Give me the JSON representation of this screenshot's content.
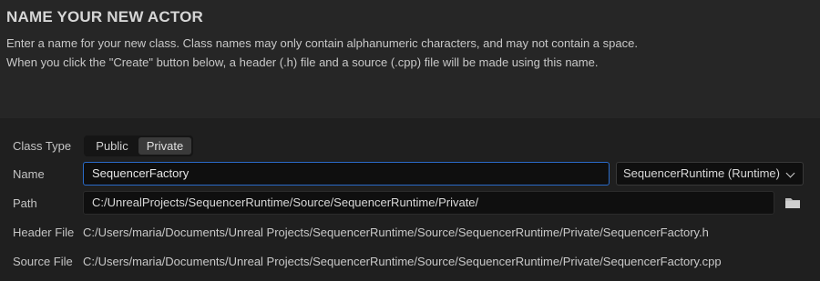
{
  "dialog": {
    "title": "NAME YOUR NEW ACTOR",
    "description_line1": "Enter a name for your new class. Class names may only contain alphanumeric characters, and may not contain a space.",
    "description_line2": "When you click the \"Create\" button below, a header (.h) file and a source (.cpp) file will be made using this name."
  },
  "form": {
    "class_type": {
      "label": "Class Type",
      "options": [
        "Public",
        "Private"
      ],
      "selected": "Private"
    },
    "name": {
      "label": "Name",
      "value": "SequencerFactory"
    },
    "module": {
      "selected": "SequencerRuntime (Runtime)"
    },
    "path": {
      "label": "Path",
      "value": "C:/UnrealProjects/SequencerRuntime/Source/SequencerRuntime/Private/"
    },
    "header_file": {
      "label": "Header File",
      "value": "C:/Users/maria/Documents/Unreal Projects/SequencerRuntime/Source/SequencerRuntime/Private/SequencerFactory.h"
    },
    "source_file": {
      "label": "Source File",
      "value": "C:/Users/maria/Documents/Unreal Projects/SequencerRuntime/Source/SequencerRuntime/Private/SequencerFactory.cpp"
    }
  },
  "icons": {
    "browse": "folder-icon",
    "dropdown": "chevron-down-icon"
  },
  "colors": {
    "focus_border": "#2a6bc9",
    "background": "#262626",
    "form_background": "#1f1f1f"
  }
}
